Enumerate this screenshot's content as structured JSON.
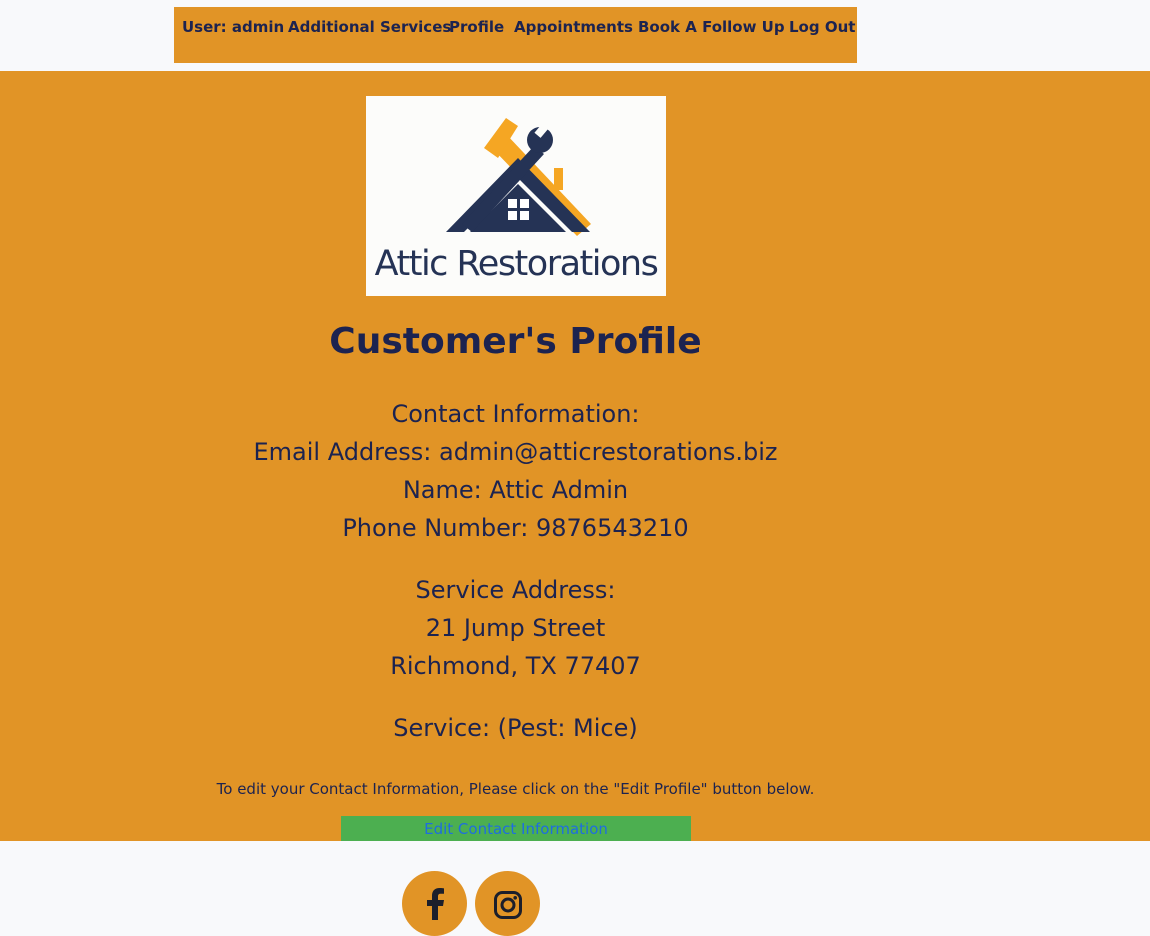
{
  "nav": {
    "user": "User: admin",
    "additional_services": "Additional Services",
    "profile": "Profile",
    "appointments": "Appointments",
    "book_follow_up": "Book A Follow Up",
    "log_out": "Log Out"
  },
  "logo": {
    "text": "Attic Restorations",
    "icon": "house-hammer-wrench-logo"
  },
  "page": {
    "title": "Customer's Profile"
  },
  "contact": {
    "heading": "Contact Information:",
    "email": "Email Address: admin@atticrestorations.biz",
    "name": "Name: Attic Admin",
    "phone": "Phone Number: 9876543210"
  },
  "address": {
    "heading": "Service Address:",
    "street": "21 Jump Street",
    "city": "Richmond, TX 77407"
  },
  "service": {
    "text": "Service: (Pest: Mice)"
  },
  "hint": "To edit your Contact Information, Please click on the \"Edit Profile\" button below.",
  "edit_button": "Edit Contact Information",
  "social": {
    "facebook_icon": "facebook-icon",
    "instagram_icon": "instagram-icon"
  },
  "colors": {
    "accent": "#e19426",
    "text": "#1c2350",
    "button": "#4caf50",
    "button_text": "#1e6de0",
    "background": "#f8f9fb"
  }
}
